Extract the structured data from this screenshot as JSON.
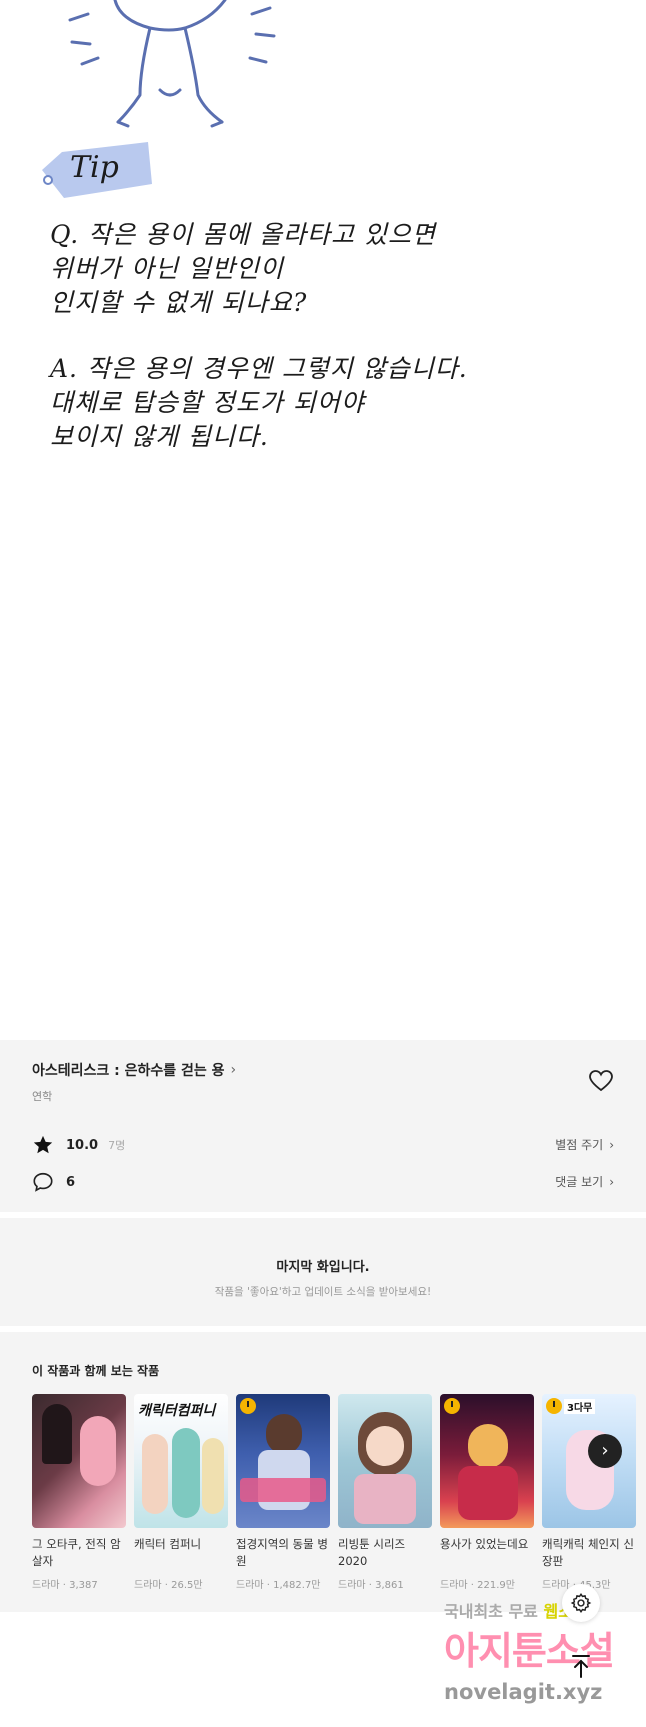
{
  "comic": {
    "tip_label": "Tip",
    "lines": [
      "Q. 작은 용이 몸에 올라타고 있으면",
      "위버가 아닌 일반인이",
      "인지할 수 없게 되나요?",
      "A. 작은 용의 경우엔 그렇지 않습니다.",
      "대체로 탑승할 정도가 되어야",
      "보이지 않게 됩니다."
    ]
  },
  "info": {
    "title": "아스테리스크 : 은하수를 걷는 용",
    "author": "연학",
    "rating": "10.0",
    "rating_count": "7명",
    "comments": "6",
    "rate_action": "별점 주기",
    "comment_action": "댓글 보기"
  },
  "last_episode": {
    "heading": "마지막 화입니다.",
    "sub": "작품을 '좋아요'하고 업데이트 소식을 받아보세요!"
  },
  "recs": {
    "heading": "이 작품과 함께 보는 작품",
    "items": [
      {
        "title": "그 오타쿠, 전직 암살자",
        "meta": "드라마 · 3,387"
      },
      {
        "title": "캐릭터 컴퍼니",
        "meta": "드라마 · 26.5만"
      },
      {
        "title": "접경지역의 동물 병원",
        "meta": "드라마 · 1,482.7만"
      },
      {
        "title": "리빙툰 시리즈 2020",
        "meta": "드라마 · 3,861"
      },
      {
        "title": "용사가 있었는데요",
        "meta": "드라마 · 221.9만"
      },
      {
        "title": "캐릭캐릭 체인지 신장판",
        "meta": "드라마 · 45.3만"
      }
    ],
    "cover_texts": [
      "캐릭터컴퍼니",
      "3다무"
    ]
  },
  "watermark": {
    "line1_a": "국내최초 무료",
    "line1_b": "웹소설",
    "line2": "아지툰소설",
    "line3": "novelagit.xyz"
  },
  "colors": {
    "accent": "#f5b400",
    "panel": "#f4f4f4",
    "watermark_pink": "#ff8fb0"
  }
}
